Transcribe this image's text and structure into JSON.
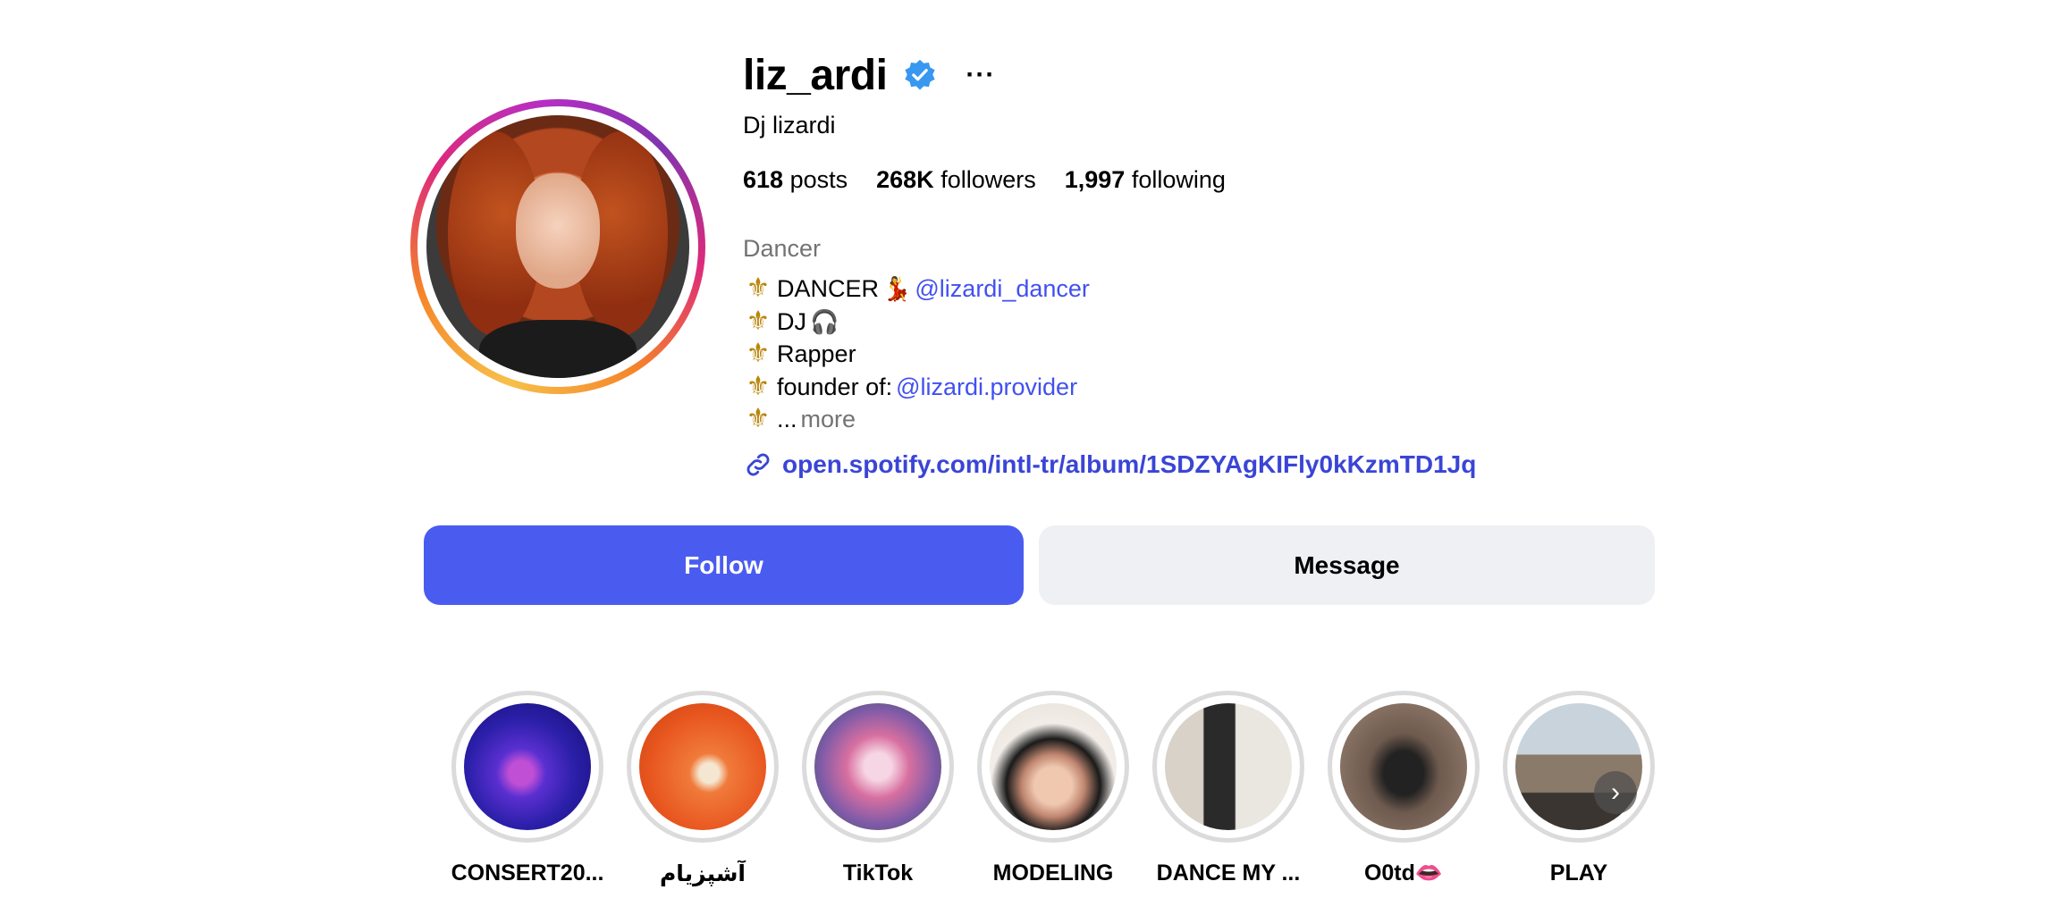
{
  "profile": {
    "username": "liz_ardi",
    "full_name": "Dj lizardi",
    "more_icon": "ellipsis-icon",
    "verified_color": "#3897f0",
    "stats": {
      "posts_count": "618",
      "posts_label": "posts",
      "followers_count": "268K",
      "followers_label": "followers",
      "following_count": "1,997",
      "following_label": "following"
    },
    "category": "Dancer",
    "bio": {
      "line1_text": "DANCER",
      "line1_emoji": "💃",
      "line1_mention": "@lizardi_dancer",
      "line2_text": "DJ",
      "line2_emoji": "🎧",
      "line3_text": "Rapper",
      "line4_text": "founder of:",
      "line4_mention": "@lizardi.provider",
      "line5_text": "...",
      "more_label": "more",
      "bullet": "⚜"
    },
    "link": "open.spotify.com/intl-tr/album/1SDZYAgKIFly0kKzmTD1Jq"
  },
  "actions": {
    "follow_label": "Follow",
    "message_label": "Message",
    "follow_color": "#4a5cf0"
  },
  "highlights": [
    {
      "label": "CONSERT20..."
    },
    {
      "label": "آشپزیام"
    },
    {
      "label": "TikTok"
    },
    {
      "label": "MODELING"
    },
    {
      "label": "DANCE MY ..."
    },
    {
      "label": "O0td👄"
    },
    {
      "label": "PLAY"
    }
  ]
}
